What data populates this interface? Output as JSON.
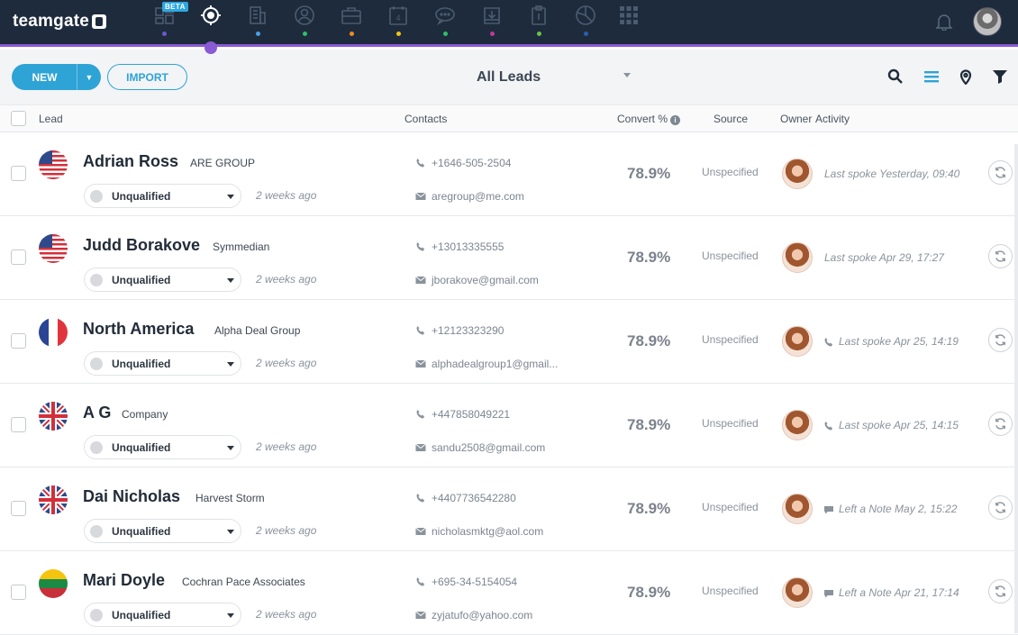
{
  "app": {
    "logo_text": "teamgate"
  },
  "nav": {
    "beta_badge": "BETA",
    "items": [
      {
        "icon": "dashboard-icon",
        "dot": "#6a5acd"
      },
      {
        "icon": "leads-target-icon",
        "dot": "#8a5bd4",
        "active": true
      },
      {
        "icon": "companies-building-icon",
        "dot": "#4aa0e6"
      },
      {
        "icon": "people-icon",
        "dot": "#2fbf6a"
      },
      {
        "icon": "deals-briefcase-icon",
        "dot": "#f08a24"
      },
      {
        "icon": "calendar-icon",
        "dot": "#f2c318",
        "text": "4"
      },
      {
        "icon": "chat-icon",
        "dot": "#2fbf6a"
      },
      {
        "icon": "inbox-icon",
        "dot": "#c0399a"
      },
      {
        "icon": "clipboard-icon",
        "dot": "#6cc24a"
      },
      {
        "icon": "reports-pie-icon",
        "dot": "#2a5fae"
      },
      {
        "icon": "apps-grid-icon"
      }
    ]
  },
  "toolbar": {
    "new_label": "NEW",
    "import_label": "IMPORT",
    "view_title": "All Leads"
  },
  "columns": {
    "lead": "Lead",
    "contacts": "Contacts",
    "convert": "Convert %",
    "source": "Source",
    "owner": "Owner",
    "activity": "Activity"
  },
  "leads": [
    {
      "name": "Adrian Ross",
      "company": "ARE GROUP",
      "flag": "us",
      "status": "Unqualified",
      "ago": "2 weeks ago",
      "phone": "+1646-505-2504",
      "email": "aregroup@me.com",
      "convert": "78.9%",
      "source": "Unspecified",
      "activity_icon": "",
      "activity": "Last spoke Yesterday, 09:40"
    },
    {
      "name": "Judd Borakove",
      "company": "Symmedian",
      "flag": "us",
      "status": "Unqualified",
      "ago": "2 weeks ago",
      "phone": "+13013335555",
      "email": "jborakove@gmail.com",
      "convert": "78.9%",
      "source": "Unspecified",
      "activity_icon": "",
      "activity": "Last spoke Apr 29, 17:27"
    },
    {
      "name": "North America",
      "company": "Alpha Deal Group",
      "flag": "fr",
      "status": "Unqualified",
      "ago": "2 weeks ago",
      "phone": "+12123323290",
      "email": "alphadealgroup1@gmail...",
      "convert": "78.9%",
      "source": "Unspecified",
      "activity_icon": "phone",
      "activity": "Last spoke Apr 25, 14:19"
    },
    {
      "name": "A G",
      "company": "Company",
      "flag": "gb",
      "status": "Unqualified",
      "ago": "2 weeks ago",
      "phone": "+447858049221",
      "email": "sandu2508@gmail.com",
      "convert": "78.9%",
      "source": "Unspecified",
      "activity_icon": "phone",
      "activity": "Last spoke Apr 25, 14:15"
    },
    {
      "name": "Dai Nicholas",
      "company": "Harvest Storm",
      "flag": "gb",
      "status": "Unqualified",
      "ago": "2 weeks ago",
      "phone": "+4407736542280",
      "email": "nicholasmktg@aol.com",
      "convert": "78.9%",
      "source": "Unspecified",
      "activity_icon": "note",
      "activity": "Left a Note May 2, 15:22"
    },
    {
      "name": "Mari Doyle",
      "company": "Cochran Pace Associates",
      "flag": "lt",
      "status": "Unqualified",
      "ago": "2 weeks ago",
      "phone": "+695-34-5154054",
      "email": "zyjatufo@yahoo.com",
      "convert": "78.9%",
      "source": "Unspecified",
      "activity_icon": "note",
      "activity": "Left a Note Apr 21, 17:14"
    }
  ]
}
